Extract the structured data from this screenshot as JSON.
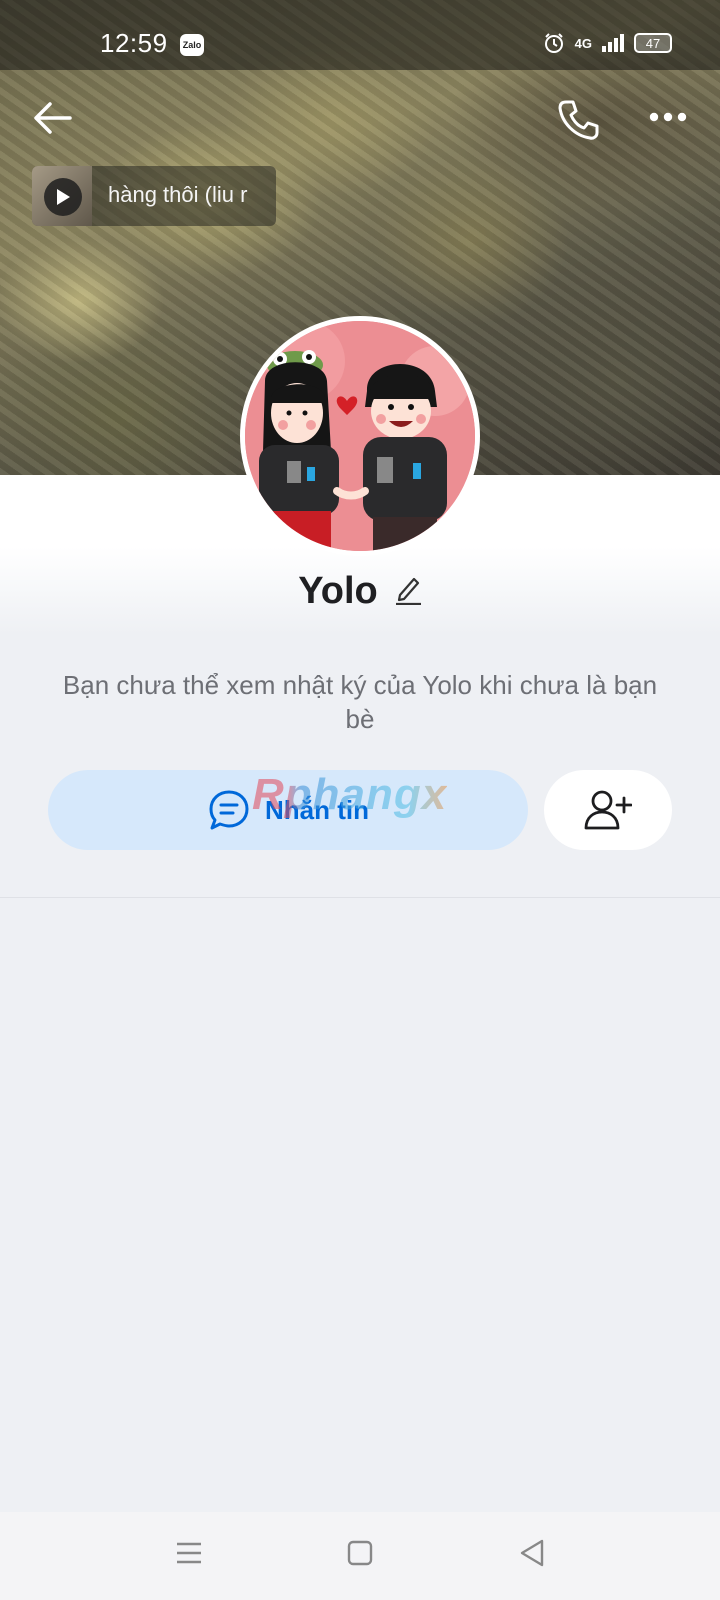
{
  "status_bar": {
    "time": "12:59",
    "app_badge": "Zalo",
    "network": "4G",
    "battery": "47"
  },
  "header": {
    "icons": [
      "back-arrow-icon",
      "phone-icon",
      "more-dots-icon"
    ]
  },
  "music": {
    "song_text": "hàng thôi (liu r"
  },
  "profile": {
    "name": "Yolo",
    "edit_icon": "pencil-icon",
    "diary_notice": "Bạn chưa thể xem nhật ký của Yolo khi chưa là bạn bè"
  },
  "actions": {
    "message_label": "Nhắn tin",
    "message_icon": "chat-bubble-icon",
    "add_friend_icon": "add-friend-icon"
  },
  "watermark": {
    "text": "Rphangx"
  },
  "colors": {
    "accent": "#0068d9",
    "button_bg": "#d6e8fb",
    "page_bg": "#eef0f4"
  },
  "nav_bar": {
    "icons": [
      "menu-icon",
      "home-square-icon",
      "back-triangle-icon"
    ]
  }
}
